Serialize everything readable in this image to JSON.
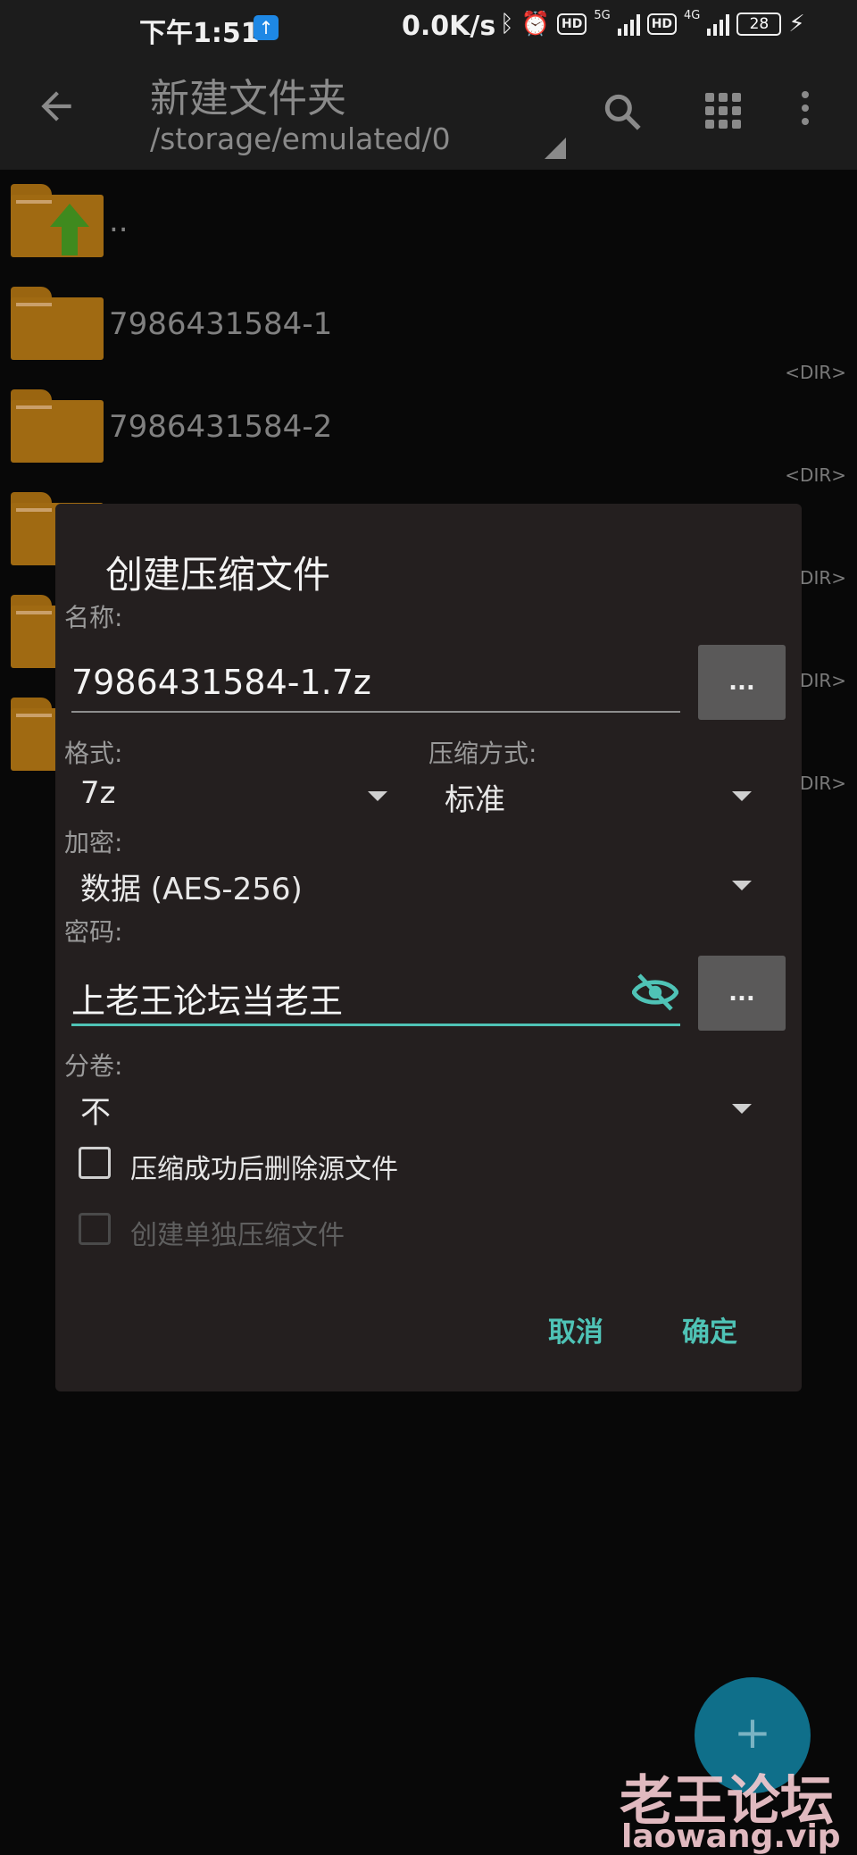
{
  "status_bar": {
    "time": "下午1:51",
    "speed": "0.0K/s",
    "battery": "28",
    "net1": "5G",
    "net2": "4G",
    "hd": "HD"
  },
  "app_bar": {
    "title": "新建文件夹",
    "path": "/storage/emulated/0"
  },
  "files": [
    {
      "name": "..",
      "type": ""
    },
    {
      "name": "7986431584-1",
      "type": "<DIR>"
    },
    {
      "name": "7986431584-2",
      "type": "<DIR>"
    },
    {
      "name": "",
      "type": "<DIR>"
    },
    {
      "name": "",
      "type": "<DIR>"
    },
    {
      "name": "",
      "type": "<DIR>"
    }
  ],
  "dialog": {
    "title": "创建压缩文件",
    "name_label": "名称:",
    "name_value": "7986431584-1.7z",
    "browse_label": "...",
    "format_label": "格式:",
    "format_value": "7z",
    "method_label": "压缩方式:",
    "method_value": "标准",
    "encryption_label": "加密:",
    "encryption_value": "数据 (AES-256)",
    "password_label": "密码:",
    "password_value": "上老王论坛当老王",
    "volume_label": "分卷:",
    "volume_value": "不",
    "delete_source_label": "压缩成功后删除源文件",
    "separate_label": "创建单独压缩文件",
    "cancel_label": "取消",
    "ok_label": "确定"
  },
  "fab_label": "+",
  "watermark": {
    "cn": "老王论坛",
    "en": "laowang.vip"
  },
  "colors": {
    "accent": "#4fc3b6",
    "folder": "#a06a12",
    "dialog_bg": "#241f1f"
  }
}
